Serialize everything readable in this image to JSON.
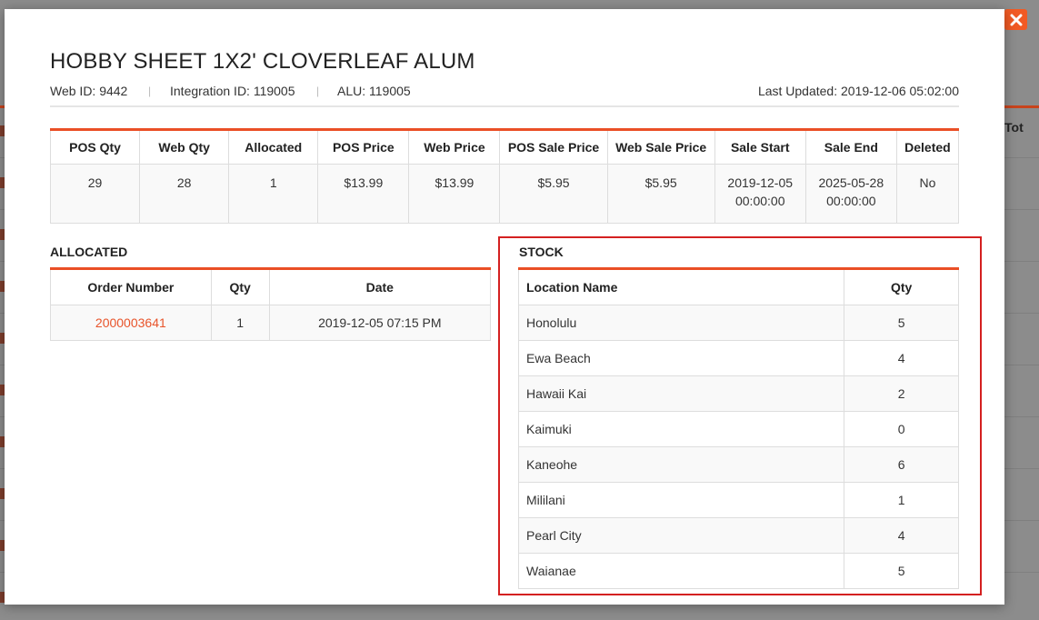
{
  "product": {
    "title": "HOBBY SHEET 1X2' CLOVERLEAF ALUM",
    "web_id": "Web ID: 9442",
    "integration_id": "Integration ID: 119005",
    "alu": "ALU: 119005",
    "separator": "|",
    "last_updated": "Last Updated: 2019-12-06 05:02:00"
  },
  "summary": {
    "headers": [
      "POS Qty",
      "Web Qty",
      "Allocated",
      "POS Price",
      "Web Price",
      "POS Sale Price",
      "Web Sale Price",
      "Sale Start",
      "Sale End",
      "Deleted"
    ],
    "row": {
      "pos_qty": "29",
      "web_qty": "28",
      "allocated": "1",
      "pos_price": "$13.99",
      "web_price": "$13.99",
      "pos_sale_price": "$5.95",
      "web_sale_price": "$5.95",
      "sale_start_date": "2019-12-05",
      "sale_start_time": "00:00:00",
      "sale_end_date": "2025-05-28",
      "sale_end_time": "00:00:00",
      "deleted": "No"
    }
  },
  "allocated": {
    "label": "ALLOCATED",
    "headers": [
      "Order Number",
      "Qty",
      "Date"
    ],
    "rows": [
      {
        "order_number": "2000003641",
        "qty": "1",
        "date": "2019-12-05 07:15 PM"
      }
    ]
  },
  "stock": {
    "label": "STOCK",
    "headers": [
      "Location Name",
      "Qty"
    ],
    "rows": [
      {
        "location": "Honolulu",
        "qty": "5"
      },
      {
        "location": "Ewa Beach",
        "qty": "4"
      },
      {
        "location": "Hawaii Kai",
        "qty": "2"
      },
      {
        "location": "Kaimuki",
        "qty": "0"
      },
      {
        "location": "Kaneohe",
        "qty": "6"
      },
      {
        "location": "Mililani",
        "qty": "1"
      },
      {
        "location": "Pearl City",
        "qty": "4"
      },
      {
        "location": "Waianae",
        "qty": "5"
      }
    ]
  },
  "background": {
    "column_header_fragment": "Tot"
  },
  "colors": {
    "accent": "#ea4f26",
    "close_button": "#f15a24",
    "highlight_frame": "#d42020",
    "link": "#e8542b"
  },
  "icons": {
    "close": "close-icon"
  }
}
